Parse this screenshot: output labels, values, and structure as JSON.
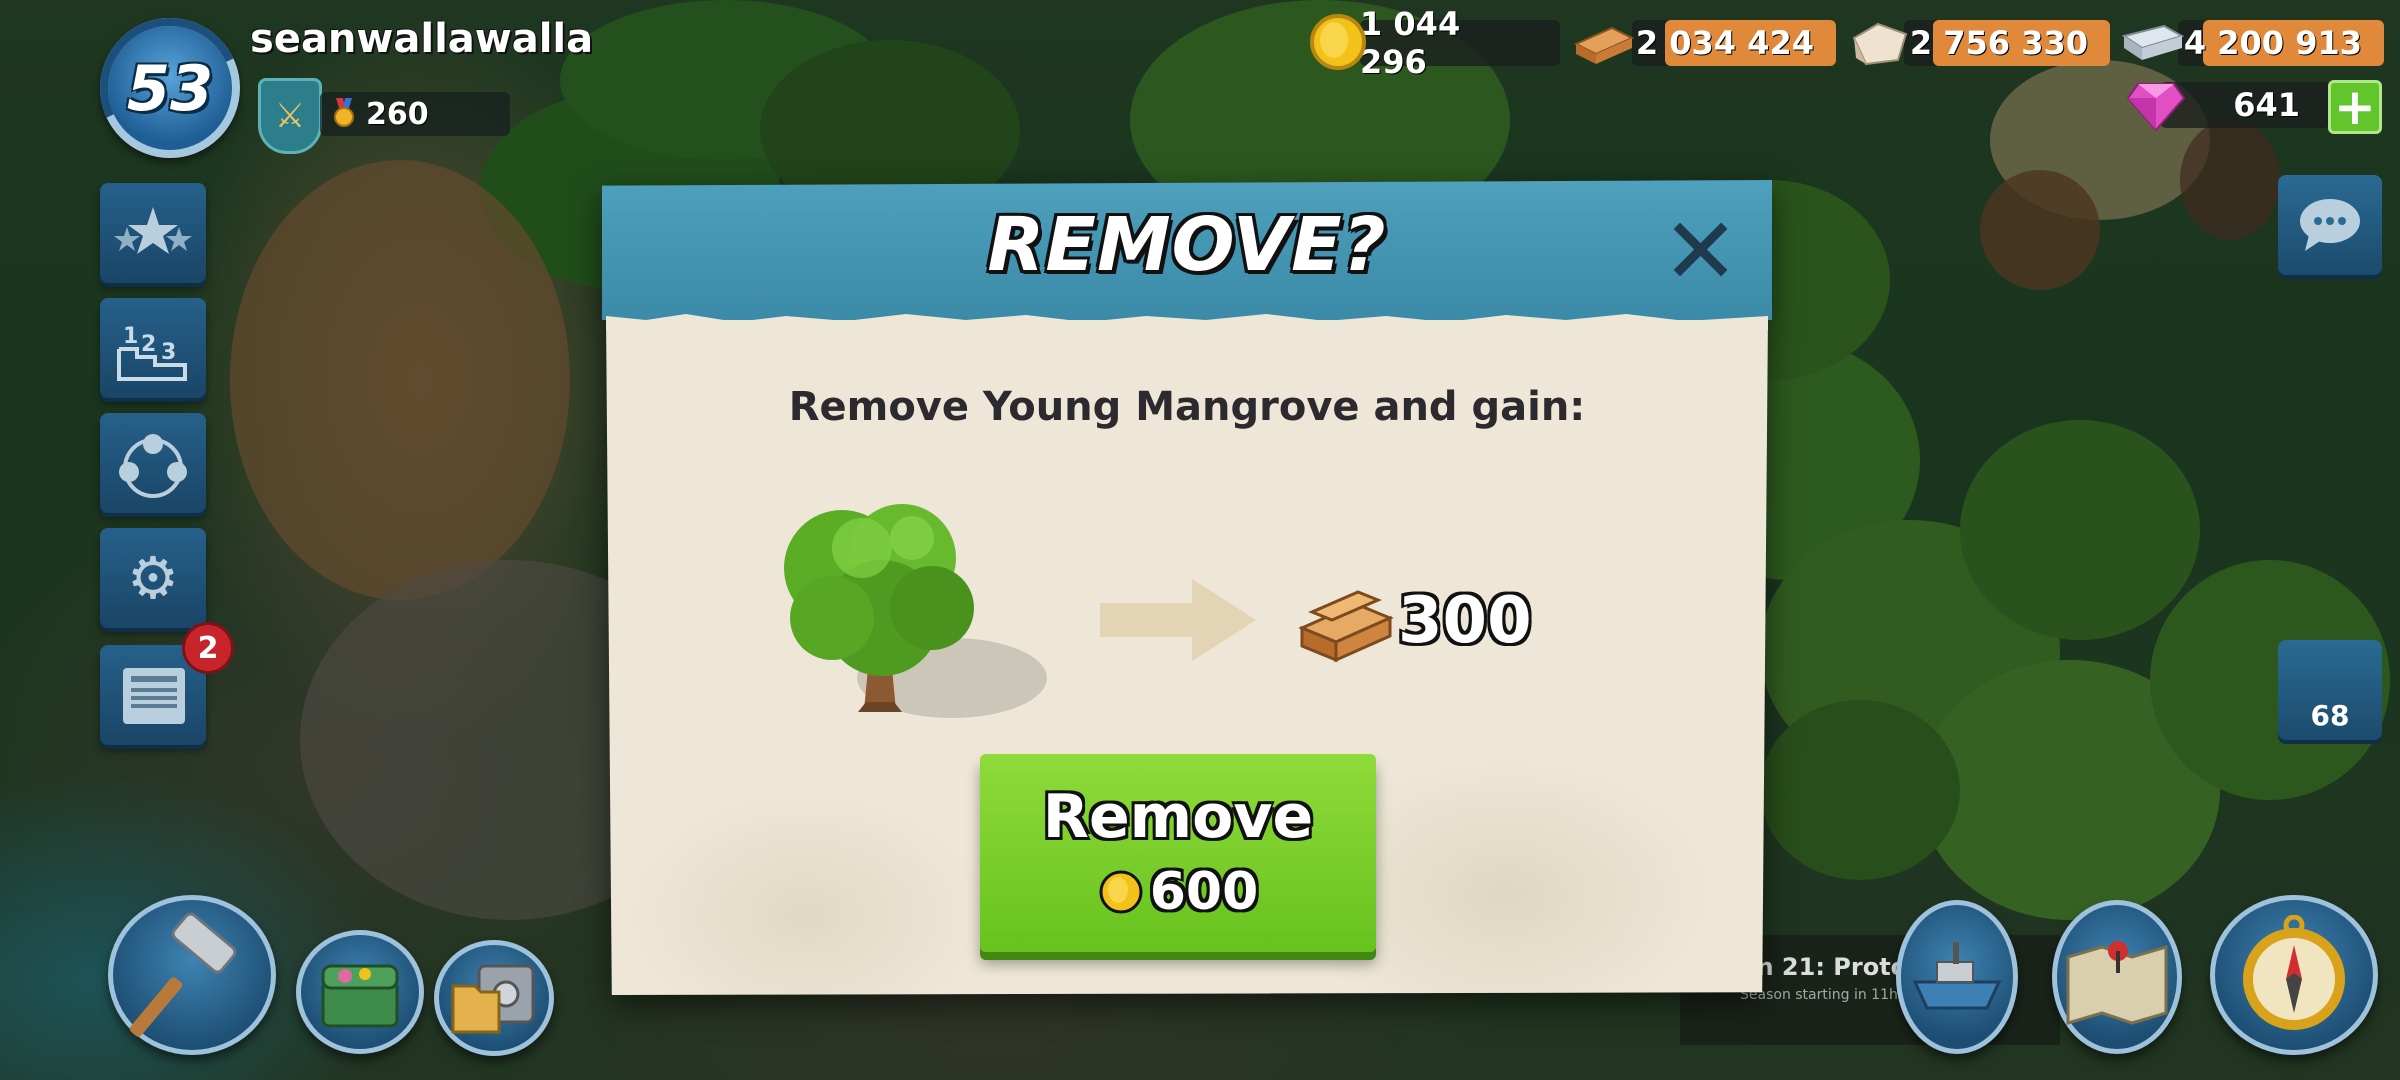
{
  "player": {
    "level": "53",
    "name": "seanwallawalla",
    "medals": "260"
  },
  "resources": {
    "gold": "1 044 296",
    "wood": "2 034 424",
    "stone": "2 756 330",
    "iron": "4 200 913",
    "gems": "641"
  },
  "sidebar": {
    "news_badge": "2"
  },
  "troops": {
    "count": "68"
  },
  "season": {
    "title": "on 21: Protos",
    "subtitle": "Season starting in 11h 50m"
  },
  "dialog": {
    "title": "REMOVE?",
    "message": "Remove Young Mangrove and gain:",
    "gain_amount": "300",
    "button_label": "Remove",
    "cost": "600"
  },
  "colors": {
    "header": "#3a8aa8",
    "button": "#67c21e",
    "parchment": "#eee7d7"
  }
}
